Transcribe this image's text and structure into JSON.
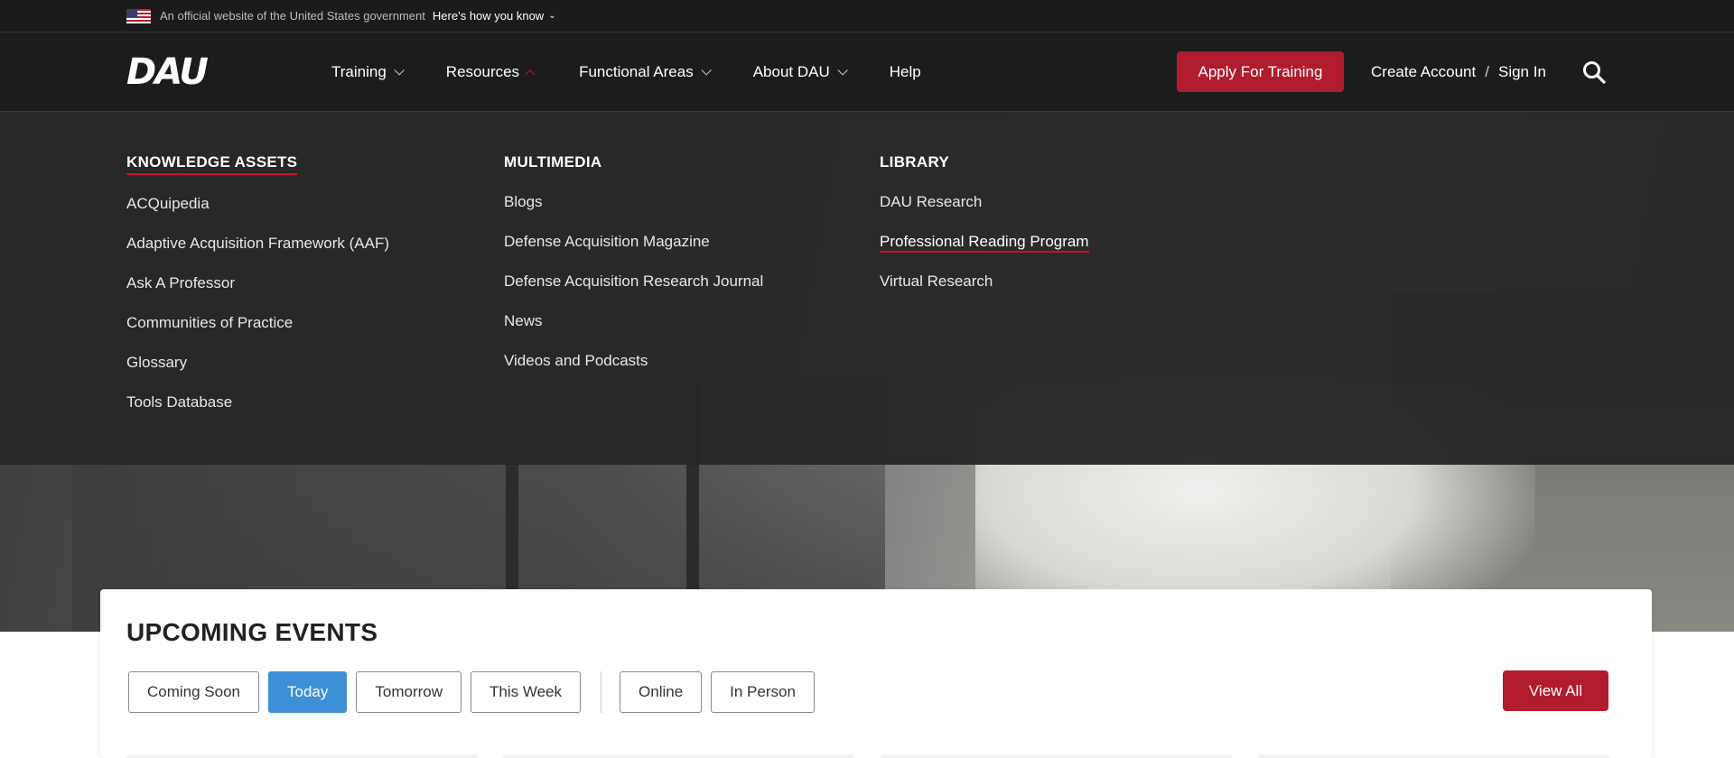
{
  "gov_banner": {
    "text": "An official website of the United States government",
    "link": "Here’s how you know"
  },
  "header": {
    "logo": "DAU",
    "nav": [
      {
        "label": "Training"
      },
      {
        "label": "Resources"
      },
      {
        "label": "Functional Areas"
      },
      {
        "label": "About DAU"
      },
      {
        "label": "Help"
      }
    ],
    "apply_label": "Apply For Training",
    "create_account": "Create Account",
    "separator": "/",
    "sign_in": "Sign In"
  },
  "mega_menu": {
    "columns": [
      {
        "heading": "KNOWLEDGE ASSETS",
        "items": [
          "ACQuipedia",
          "Adaptive Acquisition Framework (AAF)",
          "Ask A Professor",
          "Communities of Practice",
          "Glossary",
          "Tools Database"
        ]
      },
      {
        "heading": "MULTIMEDIA",
        "items": [
          "Blogs",
          "Defense Acquisition Magazine",
          "Defense Acquisition Research Journal",
          "News",
          "Videos and Podcasts"
        ]
      },
      {
        "heading": "LIBRARY",
        "items": [
          "DAU Research",
          "Professional Reading Program",
          "Virtual Research"
        ]
      }
    ]
  },
  "events": {
    "title": "UPCOMING EVENTS",
    "filters": [
      "Coming Soon",
      "Today",
      "Tomorrow",
      "This Week"
    ],
    "mode_filters": [
      "Online",
      "In Person"
    ],
    "view_all": "View All"
  },
  "colors": {
    "accent_red": "#b01c2e",
    "active_blue": "#3d8fd6",
    "header_bg": "#1c1c1c"
  }
}
